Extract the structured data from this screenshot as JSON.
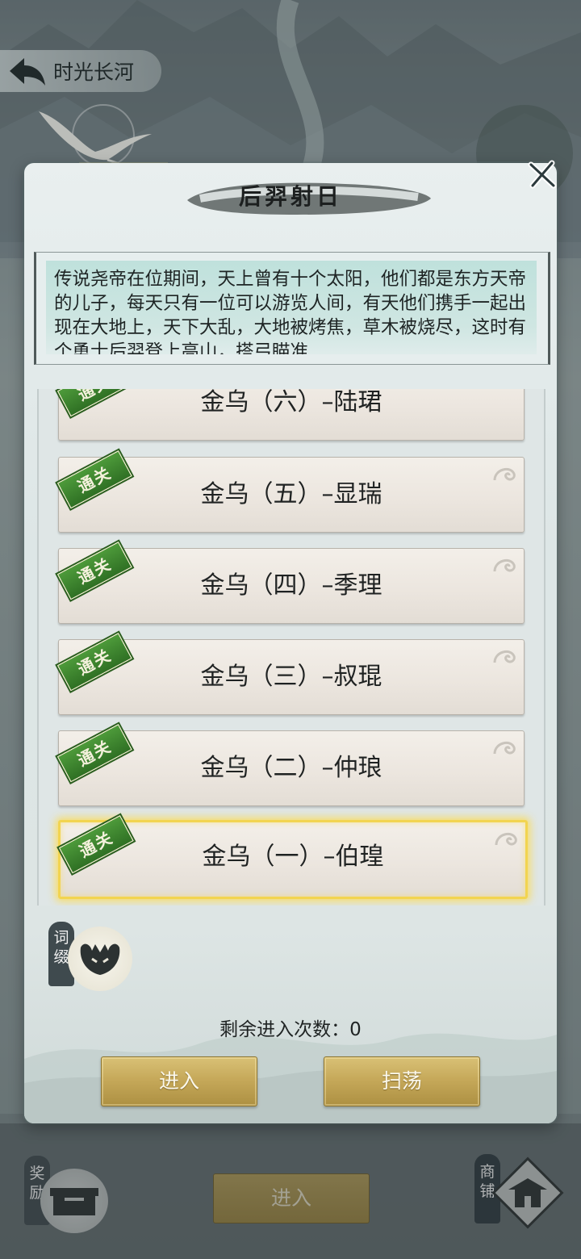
{
  "header": {
    "title": "时光长河"
  },
  "modal": {
    "title": "后羿射日",
    "description": "传说尧帝在位期间，天上曾有十个太阳，他们都是东方天帝的儿子，每天只有一位可以游览人间，有天他们携手一起出现在大地上，天下大乱，大地被烤焦，草木被烧尽，这时有个勇士后羿登上高山，搭弓瞄准",
    "cleared_badge": "通关",
    "stages": [
      {
        "label": "金乌（六）–陆珺"
      },
      {
        "label": "金乌（五）–显瑞"
      },
      {
        "label": "金乌（四）–季理"
      },
      {
        "label": "金乌（三）–叔琨"
      },
      {
        "label": "金乌（二）–仲琅"
      },
      {
        "label": "金乌（一）–伯瑝"
      }
    ],
    "affix_label": "词缀",
    "remaining_text": "剩余进入次数：0",
    "enter_label": "进入",
    "sweep_label": "扫荡"
  },
  "bottom": {
    "reward_label": "奖励",
    "enter_label": "进入",
    "shop_label": "商铺"
  }
}
